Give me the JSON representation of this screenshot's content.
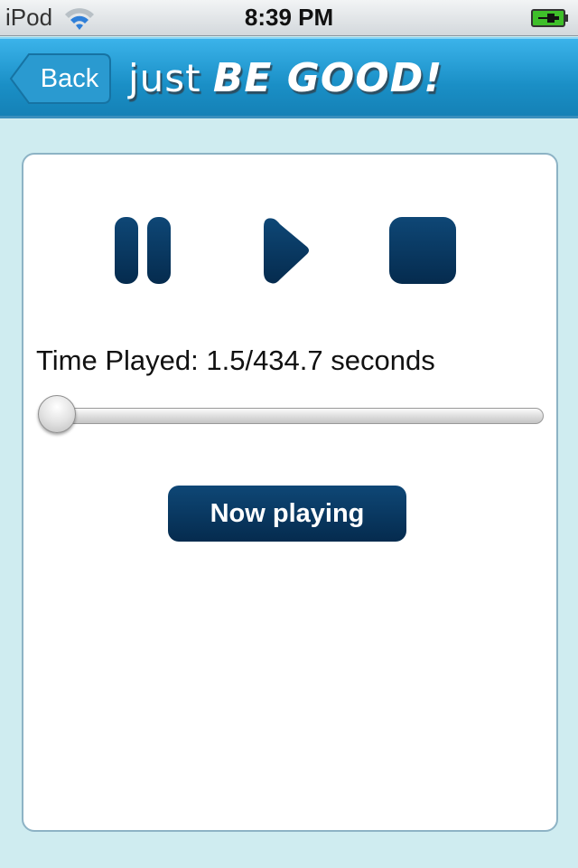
{
  "status_bar": {
    "carrier": "iPod",
    "time": "8:39 PM",
    "wifi_icon": "wifi-icon",
    "battery_icon": "battery-charging-icon",
    "battery_color": "#3fbf2a"
  },
  "nav_bar": {
    "back_label": "Back",
    "title_prefix": "just",
    "title_emphasis": "BE GOOD!",
    "color": "#1a8fc6"
  },
  "player": {
    "controls": [
      {
        "name": "pause",
        "icon": "pause-icon"
      },
      {
        "name": "play",
        "icon": "play-icon"
      },
      {
        "name": "stop",
        "icon": "stop-icon"
      }
    ],
    "time_label": "Time Played: 1.5/434.7 seconds",
    "time_played_seconds": 1.5,
    "duration_seconds": 434.7,
    "progress_fraction": 0.0035,
    "now_playing_label": "Now playing",
    "accent_color": "#0a3b66"
  }
}
